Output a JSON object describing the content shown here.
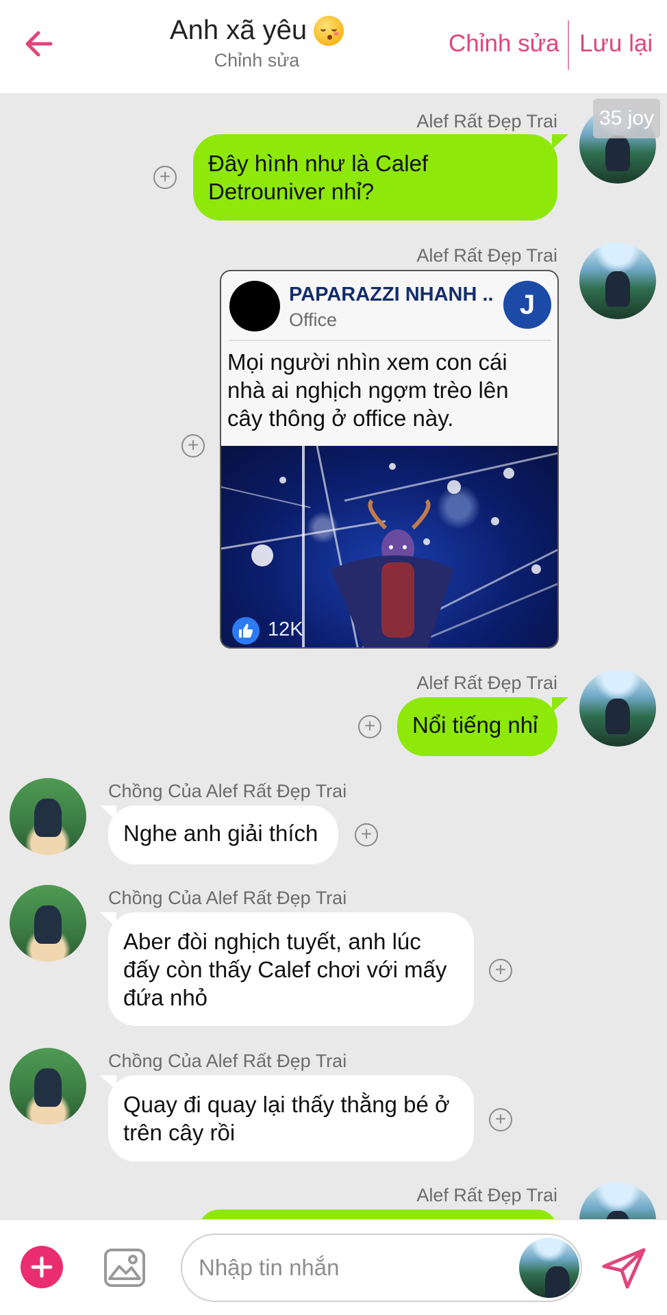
{
  "header": {
    "title": "Anh xã yêu",
    "subtitle": "Chỉnh sửa",
    "edit_label": "Chỉnh sửa",
    "save_label": "Lưu lại",
    "accent_color": "#e0457b"
  },
  "counter": {
    "label": "35 joy"
  },
  "messages": [
    {
      "sender": "Alef Rất Đẹp Trai",
      "side": "right",
      "text": "Đây hình như là Calef Detrouniver nhỉ?"
    },
    {
      "sender": "Alef Rất Đẹp Trai",
      "side": "right",
      "card": {
        "page_name": "PAPARAZZI NHANH ...",
        "page_sub": "Office",
        "badge": "J",
        "text": "Mọi người nhìn xem con cái nhà ai nghịch ngợm trèo lên cây thông ở office này.",
        "likes": "12K"
      }
    },
    {
      "sender": "Alef Rất Đẹp Trai",
      "side": "right",
      "text": "Nổi tiếng nhỉ"
    },
    {
      "sender": "Chồng Của Alef Rất Đẹp Trai",
      "side": "left",
      "text": "Nghe anh giải thích"
    },
    {
      "sender": "Chồng Của Alef Rất Đẹp Trai",
      "side": "left",
      "text": "Aber đòi nghịch tuyết, anh lúc đấy còn thấy Calef chơi với mấy đứa nhỏ"
    },
    {
      "sender": "Chồng Của Alef Rất Đẹp Trai",
      "side": "left",
      "text": "Quay đi quay lại thấy thằng bé ở trên cây rồi"
    },
    {
      "sender": "Alef Rất Đẹp Trai",
      "side": "right",
      "text": ""
    }
  ],
  "input": {
    "placeholder": "Nhập tin nhắn"
  },
  "colors": {
    "green_bubble": "#8ee80a",
    "white_bubble": "#ffffff",
    "background": "#e9e9e9",
    "plus_button": "#ea2d6f"
  },
  "icons": [
    "back-arrow-icon",
    "add-reaction-icon",
    "like-icon",
    "plus-icon",
    "image-icon",
    "send-icon"
  ]
}
